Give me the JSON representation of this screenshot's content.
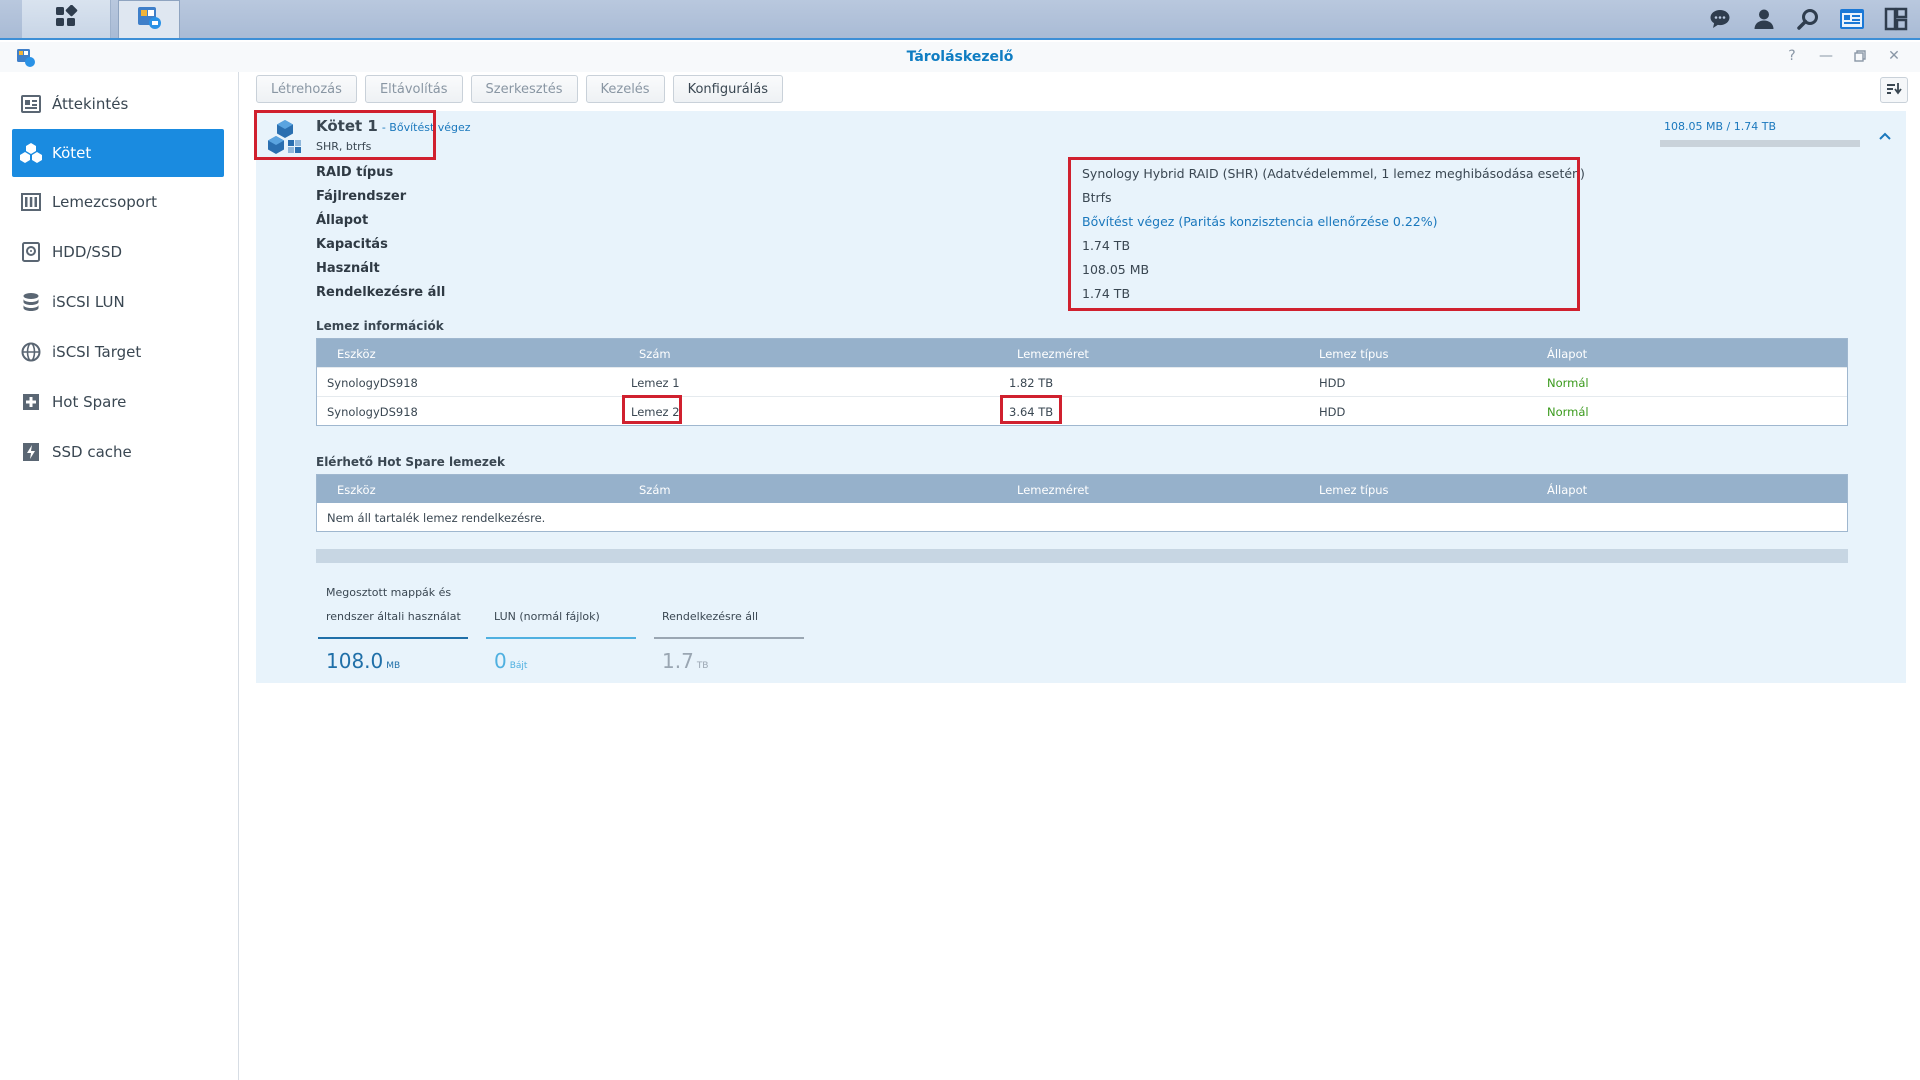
{
  "taskbar": {
    "main_menu_icon": "grid-icon",
    "app_icon": "storage-manager-icon",
    "right_icons": [
      "chat-icon",
      "user-icon",
      "search-icon",
      "widgets-icon",
      "windows-icon"
    ]
  },
  "window": {
    "title": "Tároláskezelő",
    "controls": [
      "help-icon",
      "minimize-icon",
      "maximize-icon",
      "close-icon"
    ]
  },
  "sidebar": {
    "items": [
      {
        "label": "Áttekintés",
        "icon": "overview-icon",
        "active": false
      },
      {
        "label": "Kötet",
        "icon": "volume-icon",
        "active": true
      },
      {
        "label": "Lemezcsoport",
        "icon": "disk-group-icon",
        "active": false
      },
      {
        "label": "HDD/SSD",
        "icon": "hdd-icon",
        "active": false
      },
      {
        "label": "iSCSI LUN",
        "icon": "iscsi-lun-icon",
        "active": false
      },
      {
        "label": "iSCSI Target",
        "icon": "iscsi-target-icon",
        "active": false
      },
      {
        "label": "Hot Spare",
        "icon": "hot-spare-icon",
        "active": false
      },
      {
        "label": "SSD cache",
        "icon": "ssd-cache-icon",
        "active": false
      }
    ]
  },
  "toolbar": {
    "create": "Létrehozás",
    "remove": "Eltávolítás",
    "edit": "Szerkesztés",
    "manage": "Kezelés",
    "configure": "Konfigurálás"
  },
  "volume": {
    "name": "Kötet 1",
    "status": "- Bővítést végez",
    "subtitle": "SHR, btrfs",
    "usage_text": "108.05 MB / 1.74 TB",
    "usage_fraction": 0.0001,
    "properties": [
      {
        "label": "RAID típus",
        "value": "Synology Hybrid RAID (SHR) (Adatvédelemmel, 1 lemez meghibásodása esetén)"
      },
      {
        "label": "Fájlrendszer",
        "value": "Btrfs"
      },
      {
        "label": "Állapot",
        "value": "Bővítést végez (Paritás konzisztencia ellenőrzése 0.22%)"
      },
      {
        "label": "Kapacitás",
        "value": "1.74 TB"
      },
      {
        "label": "Használt",
        "value": "108.05 MB"
      },
      {
        "label": "Rendelkezésre áll",
        "value": "1.74 TB"
      }
    ]
  },
  "disk_info": {
    "title": "Lemez információk",
    "columns": [
      "Eszköz",
      "Szám",
      "Lemezméret",
      "Lemez típus",
      "Állapot"
    ],
    "rows": [
      [
        "SynologyDS918",
        "Lemez 1",
        "1.82 TB",
        "HDD",
        "Normál"
      ],
      [
        "SynologyDS918",
        "Lemez 2",
        "3.64 TB",
        "HDD",
        "Normál"
      ]
    ]
  },
  "hot_spare": {
    "title": "Elérhető Hot Spare lemezek",
    "columns": [
      "Eszköz",
      "Szám",
      "Lemezméret",
      "Lemez típus",
      "Állapot"
    ],
    "empty": "Nem áll tartalék lemez rendelkezésre."
  },
  "stats": [
    {
      "label_line1": "Megosztott mappák és",
      "label_line2": "rendszer általi használat",
      "value": "108.0",
      "unit": "MB",
      "color": "#1f6fa8"
    },
    {
      "label_line1": "",
      "label_line2": "LUN (normál fájlok)",
      "value": "0",
      "unit": "Bájt",
      "color": "#4fb0e0"
    },
    {
      "label_line1": "",
      "label_line2": "Rendelkezésre áll",
      "value": "1.7",
      "unit": "TB",
      "color": "#9aa6b2"
    }
  ],
  "colors": {
    "accent": "#1a8be0",
    "link": "#1a78bd",
    "highlight": "#d0202e",
    "normal_status": "#3a9a1c"
  }
}
